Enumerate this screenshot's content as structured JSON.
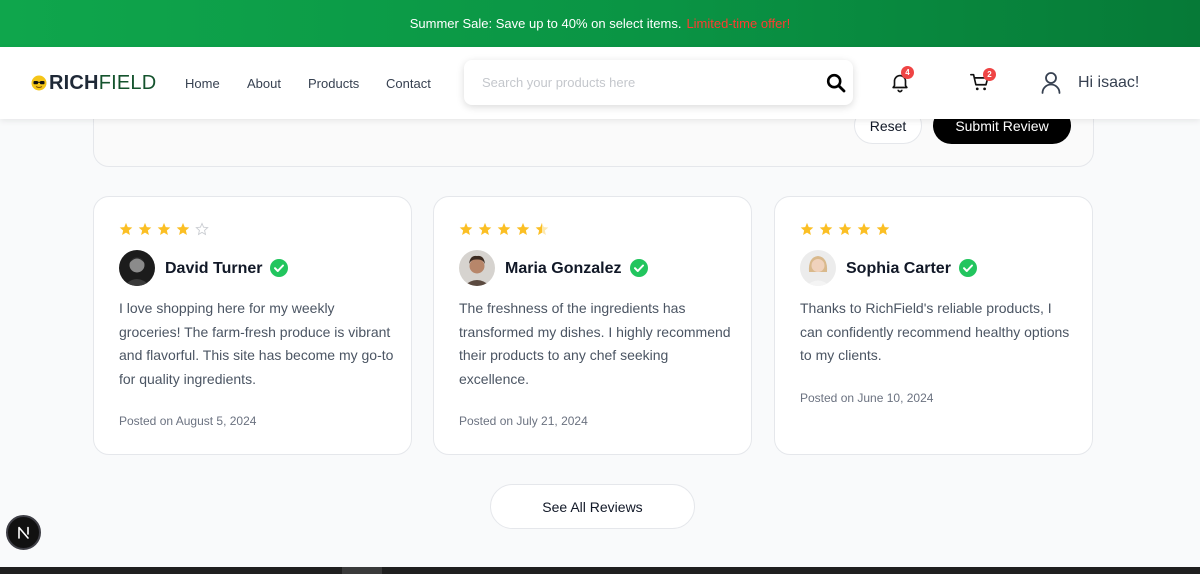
{
  "promo": {
    "text": "Summer Sale: Save up to 40% on select items.",
    "highlight": "Limited-time offer!",
    "highlight_color": "#ff3b30"
  },
  "header": {
    "brand_bold": "RICH",
    "brand_light": "FIELD",
    "nav": [
      "Home",
      "About",
      "Products",
      "Contact"
    ],
    "search_placeholder": "Search your products here",
    "notifications_count": "4",
    "cart_count": "2",
    "greeting": "Hi isaac!"
  },
  "review_form": {
    "reset_label": "Reset",
    "submit_label": "Submit Review"
  },
  "reviews": [
    {
      "name": "David Turner",
      "rating": 4,
      "text": "I love shopping here for my weekly groceries! The farm-fresh produce is vibrant and flavorful. This site has become my go-to for quality ingredients.",
      "date": "Posted on August 5, 2024",
      "verified": true
    },
    {
      "name": "Maria Gonzalez",
      "rating": 4.5,
      "text": "The freshness of the ingredients has transformed my dishes. I highly recommend their products to any chef seeking excellence.",
      "date": "Posted on July 21, 2024",
      "verified": true
    },
    {
      "name": "Sophia Carter",
      "rating": 5,
      "text": "Thanks to RichField's reliable products, I can confidently recommend healthy options to my clients.",
      "date": "Posted on June 10, 2024",
      "verified": true
    }
  ],
  "see_all_label": "See All Reviews",
  "dev_badge": "N",
  "colors": {
    "accent_green": "#0a9444",
    "star": "#fbbf24",
    "verified": "#22c55e",
    "badge_red": "#ef4444"
  }
}
